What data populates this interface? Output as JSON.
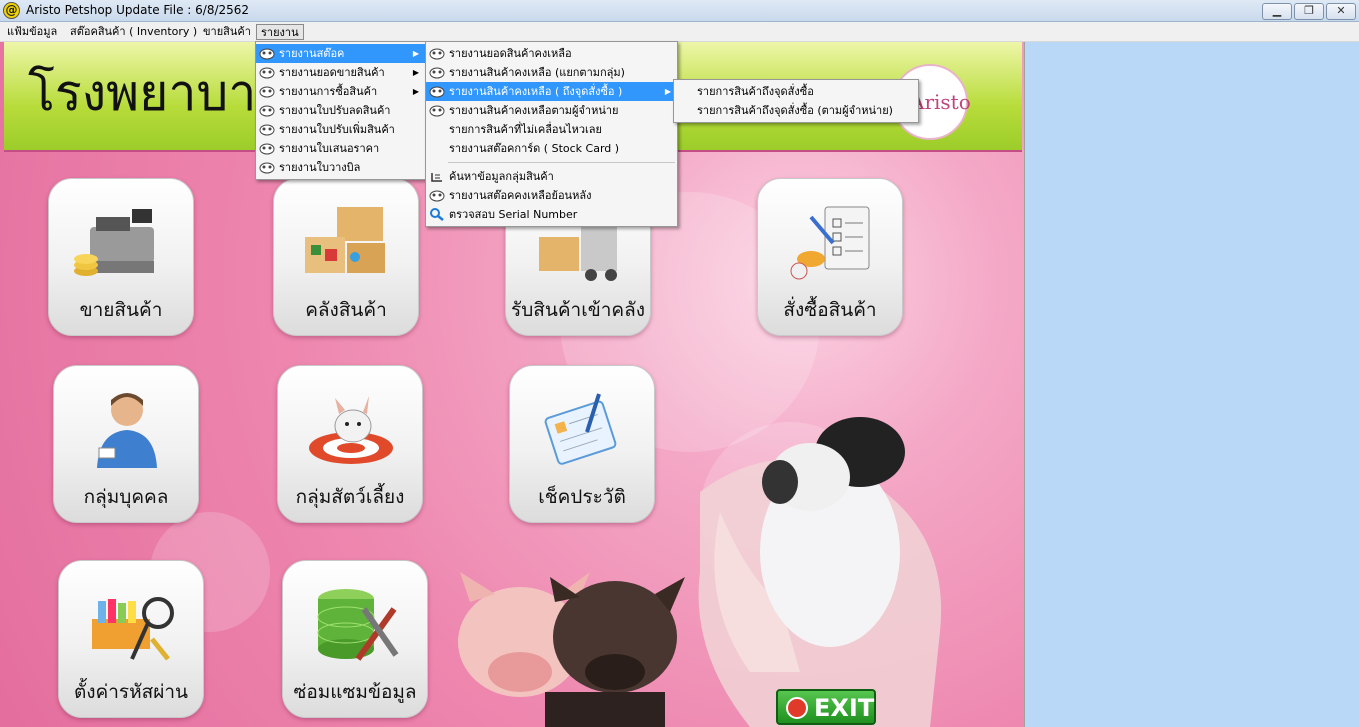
{
  "window": {
    "app_icon": "@",
    "title": "Aristo Petshop  Update File : 6/8/2562",
    "controls": {
      "minimize": "▁",
      "restore": "❐",
      "close": "✕"
    }
  },
  "menubar": [
    "แฟ้มข้อมูล",
    "สต๊อคสินค้า ( Inventory )",
    "ขายสินค้า",
    "รายงาน"
  ],
  "header": {
    "title": "โรงพยาบาลสั",
    "logo_text": "Aristo"
  },
  "tiles": [
    {
      "label": "ขายสินค้า",
      "icon": "cash-register-icon"
    },
    {
      "label": "คลังสินค้า",
      "icon": "warehouse-boxes-icon"
    },
    {
      "label": "รับสินค้าเข้าคลัง",
      "icon": "receive-goods-icon"
    },
    {
      "label": "สั่งซื้อสินค้า",
      "icon": "purchase-order-icon"
    },
    {
      "label": "กลุ่มบุคคล",
      "icon": "person-group-icon"
    },
    {
      "label": "กลุ่มสัตว์เลี้ยง",
      "icon": "pet-group-icon"
    },
    {
      "label": "เช็คประวัติ",
      "icon": "history-clipboard-icon"
    },
    {
      "label": "ตั้งค่ารหัสผ่าน",
      "icon": "password-keys-icon"
    },
    {
      "label": "ซ่อมแซมข้อมูล",
      "icon": "database-repair-icon"
    }
  ],
  "exit_label": "EXIT",
  "report_menu": [
    {
      "label": "รายงานสต๊อค",
      "submenu": true,
      "highlighted": true
    },
    {
      "label": "รายงานยอดขายสินค้า",
      "submenu": true
    },
    {
      "label": "รายงานการซื้อสินค้า",
      "submenu": true
    },
    {
      "label": "รายงานใบปรับลดสินค้า"
    },
    {
      "label": "รายงานใบปรับเพิ่มสินค้า"
    },
    {
      "label": "รายงานใบเสนอราคา"
    },
    {
      "label": "รายงานใบวางบิล"
    }
  ],
  "stock_menu": [
    {
      "label": "รายงานยอดสินค้าคงเหลือ",
      "icon": "report-icon"
    },
    {
      "label": "รายงานสินค้าคงเหลือ (แยกตามกลุ่ม)",
      "icon": "report-icon"
    },
    {
      "label": "รายงานสินค้าคงเหลือ ( ถึงจุดสั่งซื้อ )",
      "icon": "report-icon",
      "submenu": true,
      "highlighted": true
    },
    {
      "label": "รายงานสินค้าคงเหลือตามผู้จำหน่าย",
      "icon": "report-icon"
    },
    {
      "label": "รายการสินค้าที่ไม่เคลื่อนไหวเลย",
      "icon": ""
    },
    {
      "label": "รายงานสต๊อคการ์ด ( Stock Card )",
      "icon": ""
    },
    {
      "separator": true
    },
    {
      "label": "ค้นหาข้อมูลกลุ่มสินค้า",
      "icon": "group-search-icon"
    },
    {
      "label": "รายงานสต๊อคคงเหลือย้อนหลัง",
      "icon": "report-icon"
    },
    {
      "label": "ตรวจสอบ Serial Number",
      "icon": "magnifier-icon"
    }
  ],
  "reorder_menu": [
    {
      "label": "รายการสินค้าถึงจุดสั่งซื้อ"
    },
    {
      "label": "รายการสินค้าถึงจุดสั่งซื้อ (ตามผู้จำหน่าย)"
    }
  ]
}
